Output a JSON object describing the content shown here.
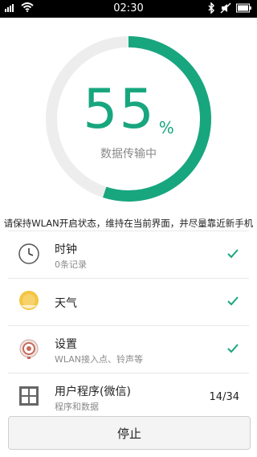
{
  "status_bar": {
    "time": "02:30",
    "icons": [
      "signal-icon",
      "wifi-icon",
      "bluetooth-icon",
      "mute-icon",
      "battery-icon"
    ]
  },
  "progress": {
    "percent_value": 55,
    "value": "55",
    "unit": "%",
    "label": "数据传输中",
    "color": "#18a67f"
  },
  "notice": "请保持WLAN开启状态，维持在当前界面，并尽量靠近新手机",
  "items": [
    {
      "title": "时钟",
      "subtitle": "0条记录",
      "icon": "clock-icon",
      "status": "check"
    },
    {
      "title": "天气",
      "subtitle": "",
      "icon": "weather-sun-icon",
      "status": "check"
    },
    {
      "title": "设置",
      "subtitle": "WLAN接入点、铃声等",
      "icon": "settings-icon",
      "status": "check"
    },
    {
      "title": "用户程序(微信)",
      "subtitle": "程序和数据",
      "icon": "apps-grid-icon",
      "status": "14/34"
    }
  ],
  "stop_button": {
    "label": "停止"
  }
}
